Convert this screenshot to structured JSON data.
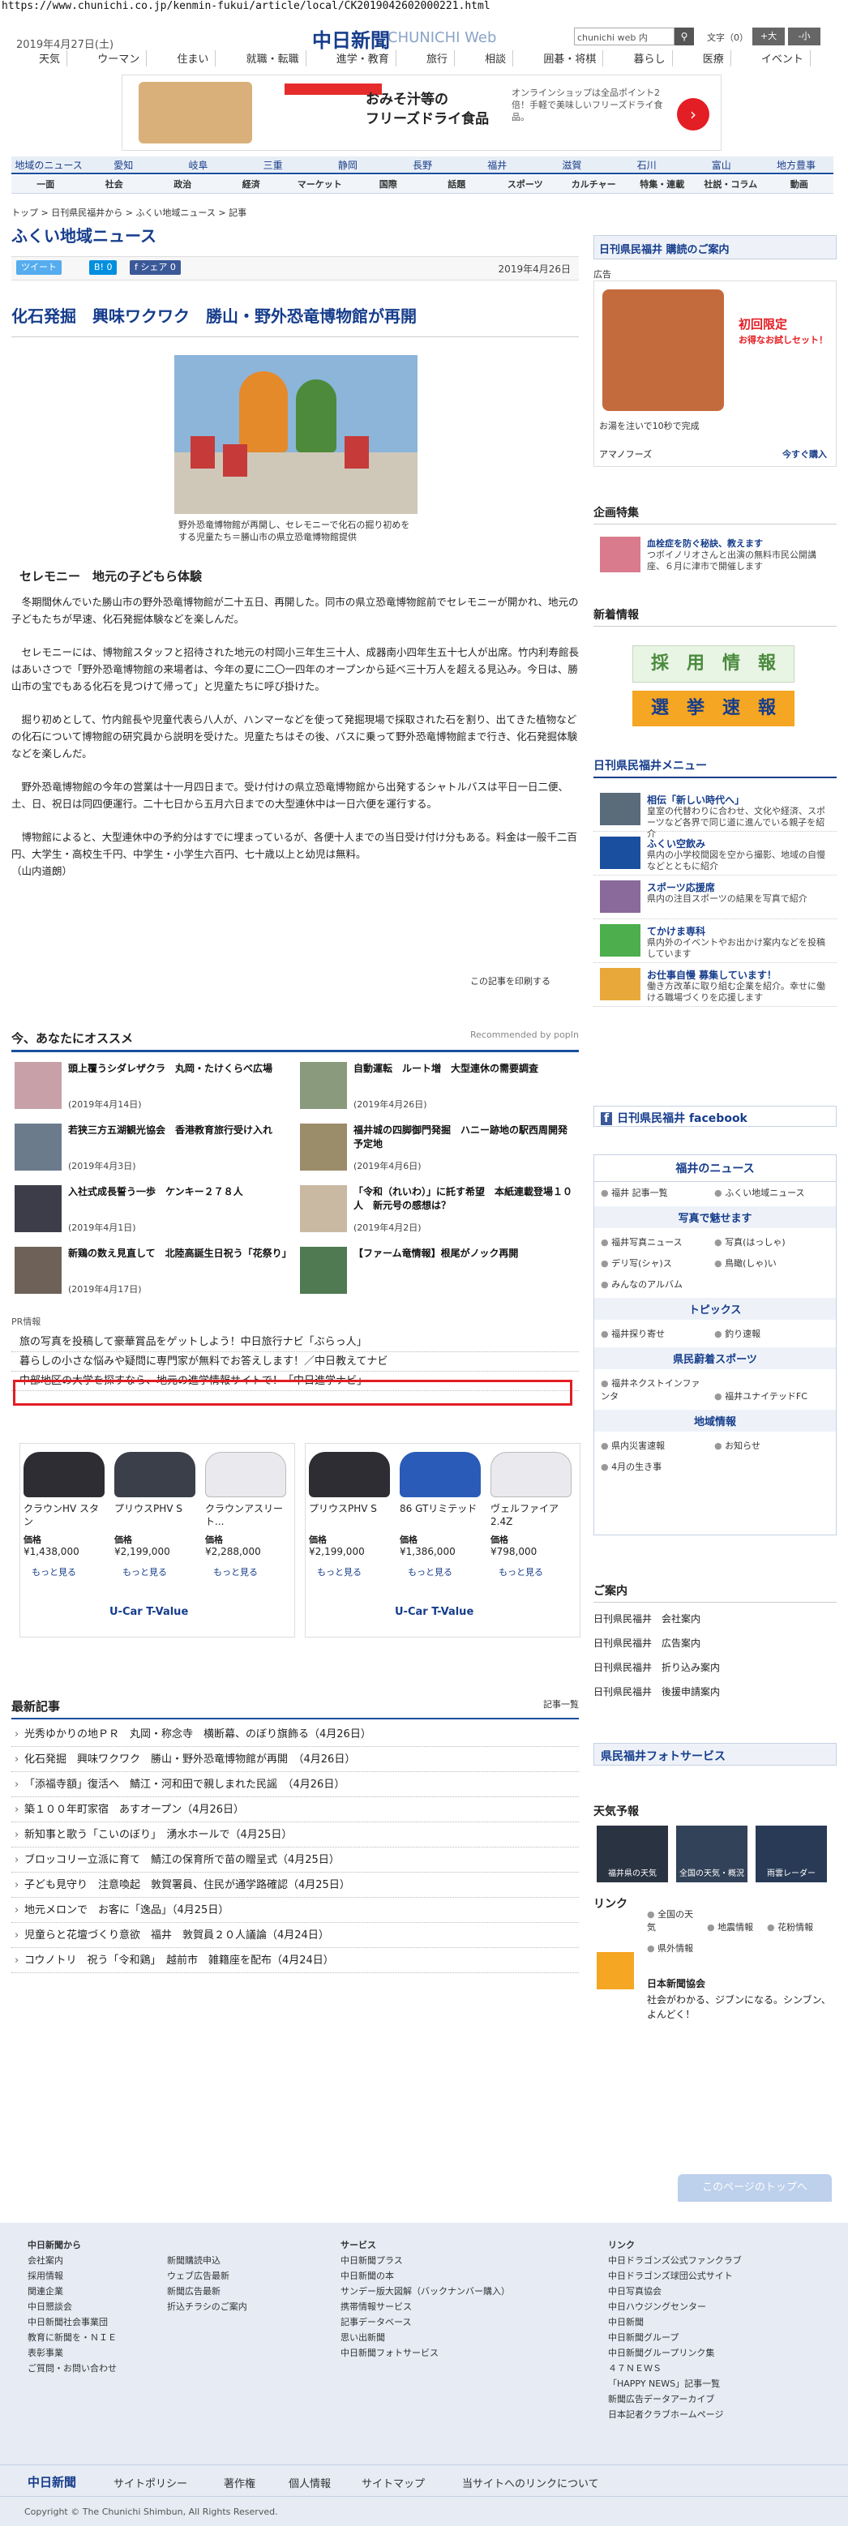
{
  "url": "https://www.chunichi.co.jp/kenmin-fukui/article/local/CK2019042602000221.html",
  "header": {
    "date": "2019年4月27日(土)",
    "logo": "中日新聞",
    "logo_web": "CHUNICHI Web",
    "search_placeholder": "chunichi web 内",
    "font_label": "文字（0）",
    "font_big": "+大",
    "font_small": "-小"
  },
  "gnav": [
    "天気",
    "ウーマン",
    "住まい",
    "就職・転職",
    "進学・教育",
    "旅行",
    "相談",
    "囲碁・将棋",
    "暮らし",
    "医療",
    "イベント"
  ],
  "ad": {
    "title": "おみそ汁等の\nフリーズドライ食品",
    "text": "オンラインショップは全品ポイント2倍！手軽で美味しいフリーズドライ食品。"
  },
  "regnav": [
    "地域のニュース",
    "愛知",
    "岐阜",
    "三重",
    "静岡",
    "長野",
    "福井",
    "滋賀",
    "石川",
    "富山",
    "地方豊事"
  ],
  "subnav": [
    "一面",
    "社会",
    "政治",
    "経済",
    "マーケット",
    "国際",
    "話題",
    "スポーツ",
    "カルチャー",
    "特集・連載",
    "社説・コラム",
    "動画"
  ],
  "breadcrumb": "トップ > 日刊県民福井から > ふくい地域ニュース > 記事",
  "section_title": "ふくい地域ニュース",
  "social": {
    "tweet": "ツイート",
    "b": "B! 0",
    "f": "f シェア 0"
  },
  "article": {
    "date": "2019年4月26日",
    "title": "化石発掘　興味ワクワク　勝山・野外恐竜博物館が再開",
    "caption": "野外恐竜博物館が再開し、セレモニーで化石の掘り初めをする児童たち＝勝山市の県立恐竜博物館提供",
    "subhead": "セレモニー　地元の子どもら体験",
    "paragraphs": [
      "冬期間休んでいた勝山市の野外恐竜博物館が二十五日、再開した。同市の県立恐竜博物館前でセレモニーが開かれ、地元の子どもたちが早速、化石発掘体験などを楽しんだ。",
      "セレモニーには、博物館スタッフと招待された地元の村岡小三年生三十人、成器南小四年生五十七人が出席。竹内利寿館長はあいさつで「野外恐竜博物館の来場者は、今年の夏に二〇一四年のオープンから延べ三十万人を超える見込み。今日は、勝山市の宝でもある化石を見つけて帰って」と児童たちに呼び掛けた。",
      "掘り初めとして、竹内館長や児童代表ら八人が、ハンマーなどを使って発掘現場で採取された石を割り、出てきた植物などの化石について博物館の研究員から説明を受けた。児童たちはその後、バスに乗って野外恐竜博物館まで行き、化石発掘体験などを楽しんだ。",
      "野外恐竜博物館の今年の営業は十一月四日まで。受け付けの県立恐竜博物館から出発するシャトルバスは平日一日二便、土、日、祝日は同四便運行。二十七日から五月六日までの大型連休中は一日六便を運行する。",
      "博物館によると、大型連休中の予約分はすでに埋まっているが、各便十人までの当日受け付け分もある。料金は一般千二百円、大学生・高校生千円、中学生・小学生六百円、七十歳以上と幼児は無料。\n（山内道朗）"
    ],
    "print": "この記事を印刷する"
  },
  "reco": {
    "title": "今、あなたにオススメ",
    "by": "Recommended by popIn",
    "items": [
      {
        "title": "頭上覆うシダレザクラ　丸岡・たけくらべ広場",
        "date": "(2019年4月14日)"
      },
      {
        "title": "自動運転　ルート増　大型連休の需要調査",
        "date": "(2019年4月26日)"
      },
      {
        "title": "若狭三方五湖観光協会　香港教育旅行受け入れ",
        "date": "(2019年4月3日)"
      },
      {
        "title": "福井城の四脚御門発掘　ハニー跡地の駅西周開発予定地",
        "date": "(2019年4月6日)"
      },
      {
        "title": "入社式成長誓う一歩　ケンキー２７８人",
        "date": "(2019年4月1日)"
      },
      {
        "title": "「令和（れいわ）」に託す希望　本紙連載登場１０人　新元号の感想は？",
        "date": "(2019年4月2日)"
      },
      {
        "title": "新鶏の数え見直して　北陸高誕生日祝う「花祭り」",
        "date": "(2019年4月17日)"
      },
      {
        "title": "【ファーム竜情報】根尾がノック再開",
        "date": ""
      }
    ]
  },
  "pr": {
    "label": "PR情報",
    "items": [
      "旅の写真を投稿して豪華賞品をゲットしよう！中日旅行ナビ「ぶらっ人」",
      "暮らしの小さな悩みや疑問に専門家が無料でお答えします！／中日教えてナビ",
      "中部地区の大学を探すなら、地元の進学情報サイトで！「中日進学ナビ」"
    ]
  },
  "cars": [
    {
      "name": "クラウンHV スタン",
      "price": "¥1,438,000"
    },
    {
      "name": "プリウスPHV S",
      "price": "¥2,199,000"
    },
    {
      "name": "クラウンアスリート...",
      "price": "¥2,288,000"
    },
    {
      "name": "プリウスPHV S",
      "price": "¥2,199,000"
    },
    {
      "name": "86 GTリミテッド",
      "price": "¥1,386,000"
    },
    {
      "name": "ヴェルファイア 2.4Z",
      "price": "¥798,000"
    }
  ],
  "car_price_label": "価格",
  "car_more": "もっと見る",
  "car_logo": "U-Car T-Value",
  "latest": {
    "title": "最新記事",
    "more": "記事一覧",
    "items": [
      "光秀ゆかりの地ＰＲ　丸岡・称念寺　横断幕、のぼり旗飾る（4月26日）",
      "化石発掘　興味ワクワク　勝山・野外恐竜博物館が再開　（4月26日）",
      "「添福寺額」復活へ　鯖江・河和田で親しまれた民謡　（4月26日）",
      "築１００年町家宿　あすオープン（4月26日）",
      "新知事と歌う「こいのぼり」　湧水ホールで（4月25日）",
      "ブロッコリー立派に育て　鯖江の保育所で苗の贈呈式（4月25日）",
      "子ども見守り　注意喚起　敦賀署員、住民が通学路確認（4月25日）",
      "地元メロンで　お客に「逸品」（4月25日）",
      "児童らと花壇づくり意欲　福井　敦賀員２０人議論（4月24日）",
      "コウノトリ　祝う「令和鶏」　越前市　雑籍座を配布（4月24日）"
    ]
  },
  "side": {
    "kenmin": "日刊県民福井 購読のご案内",
    "ad_label": "広告",
    "ad_first": "初回限定",
    "ad_sub": "お得なお試しセット！",
    "ad_text": "お湯を注いで10秒で完成",
    "ad_brand": "アマノフーズ",
    "ad_buy": "今すぐ購入",
    "kikaku": "企画特集",
    "kikaku_title": "血栓症を防ぐ秘訣、教えます",
    "kikaku_desc": "つボイノリオさんと出演の無料市民公開講座、６月に津市で開催します",
    "arrival": "新着情報",
    "recruit": "採　用　情　報",
    "election": "選　挙　速　報",
    "menu_title": "日刊県民福井メニュー",
    "menu": [
      {
        "t": "相伝「新しい時代へ」",
        "d": "皇室の代替わりに合わせ、文化や経済、スポーツなど各界で同じ道に進んでいる親子を紹介"
      },
      {
        "t": "ふくい空飲み",
        "d": "県内の小学校間図を空から撮影、地域の自慢などとともに紹介"
      },
      {
        "t": "スポーツ応援席",
        "d": "県内の注目スポーツの結果を写真で紹介"
      },
      {
        "t": "てかけま専科",
        "d": "県内外のイベントやお出かけ案内などを投稿しています"
      },
      {
        "t": "お仕事自慢 募集しています！",
        "d": "働き方改革に取り組む企業を紹介。幸せに働ける職場づくりを応援します"
      }
    ],
    "facebook": "日刊県民福井 facebook",
    "fukui_news": "福井のニュース",
    "fn_tags": [
      "福井 記事一覧",
      "ふくい地域ニュース"
    ],
    "photo_bar": "写真で魅せます",
    "photo_tags": [
      "福井写真ニュース",
      "写真(はっしゃ)",
      "デリ写(シャ)ス",
      "鳥瞰(しゃ)い",
      "みんなのアルバム"
    ],
    "topics": "トピックス",
    "topic_tags": [
      "福井探り寄せ",
      "釣り速報"
    ],
    "sports": "県民蔚着スポーツ",
    "sports_tags": [
      "福井ネクストインファンタ",
      "福井ユナイテッドFC"
    ],
    "local": "地域情報",
    "local_tags": [
      "県内災害速報",
      "お知らせ",
      "4月の生き事"
    ],
    "guide": "ご案内",
    "guide_items": [
      "日刊県民福井　会社案内",
      "日刊県民福井　広告案内",
      "日刊県民福井　折り込み案内",
      "日刊県民福井　後援申請案内"
    ],
    "photo_service": "県民福井フォトサービス",
    "weather": "天気予報",
    "weather_tiles": [
      "福井県の天気",
      "全国の天気・概況",
      "雨雲レーダー"
    ],
    "link": "リンク",
    "link_items": [
      "全国の天気",
      "地震情報",
      "花粉情報",
      "県外情報"
    ],
    "nichi": "日本新聞協会",
    "nichi_desc": "社会がわかる、ジブンになる。シンブン、よんどく！"
  },
  "footer": {
    "top_btn": "このページのトップへ",
    "col1_title": "中日新聞から",
    "col1": [
      "会社案内",
      "採用情報",
      "関連企業",
      "中日懇談会",
      "中日新聞社会事業団",
      "教育に新聞を・ＮＩＥ",
      "表彰事業",
      "ご質問・お問い合わせ"
    ],
    "col2": [
      "新聞購読申込",
      "ウェブ広告最新",
      "新聞広告最新",
      "折込チラシのご案内"
    ],
    "col3_title": "サービス",
    "col3": [
      "中日新聞プラス",
      "中日新聞の本",
      "サンデー版大図解（バックナンバー購入）",
      "携帯情報サービス",
      "記事データベース",
      "思い出新聞",
      "中日新聞フォトサービス"
    ],
    "col4_title": "リンク",
    "col4": [
      "中日ドラゴンズ公式ファンクラブ",
      "中日ドラゴンズ球団公式サイト",
      "中日写真協会",
      "中日ハウジングセンター",
      "中日新聞",
      "中日新聞グループ",
      "中日新聞グループリンク集",
      "４７ＮＥＷＳ",
      "「HAPPY NEWS」記事一覧",
      "新聞広告データアーカイブ",
      "日本記者クラブホームページ"
    ],
    "bar_logo": "中日新聞",
    "bar_items": [
      "サイトポリシー",
      "著作権",
      "個人情報",
      "サイトマップ",
      "当サイトへのリンクについて"
    ],
    "copyright": "Copyright © The Chunichi Shimbun, All Rights Reserved."
  }
}
